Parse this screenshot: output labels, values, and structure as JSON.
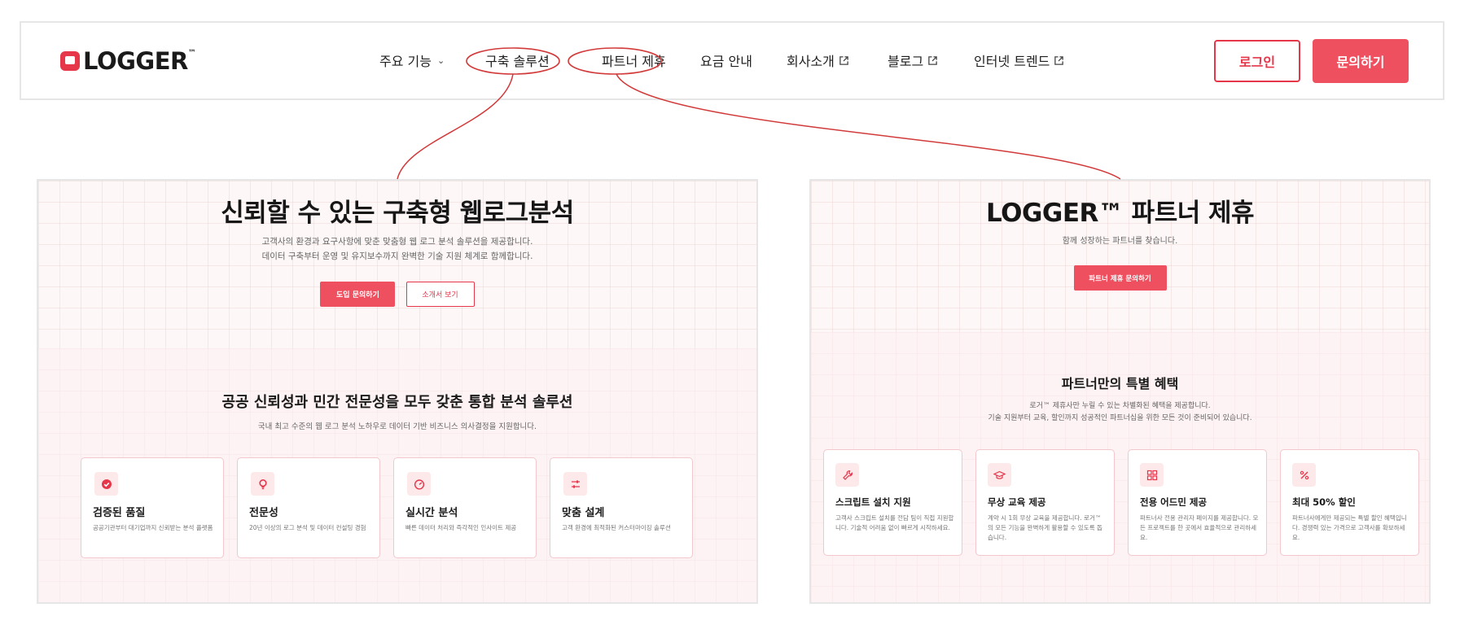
{
  "header": {
    "logo_text": "LOGGER",
    "logo_tm": "™",
    "nav": [
      {
        "label": "주요 기능",
        "has_dropdown": true
      },
      {
        "label": "구축 솔루션"
      },
      {
        "label": "파트너 제휴"
      },
      {
        "label": "요금 안내"
      },
      {
        "label": "회사소개",
        "external": true
      },
      {
        "label": "블로그",
        "external": true
      },
      {
        "label": "인터넷 트렌드",
        "external": true
      }
    ],
    "chevron": "⌄",
    "login_label": "로그인",
    "contact_label": "문의하기"
  },
  "solution_page": {
    "title": "신뢰할 수 있는 구축형 웹로그분석",
    "subtitle_line1": "고객사의 환경과 요구사항에 맞춘 맞춤형 웹 로그 분석 솔루션을 제공합니다.",
    "subtitle_line2": "데이터 구축부터 운영 및 유지보수까지 완벽한 기술 지원 체계로 함께합니다.",
    "primary_button": "도입 문의하기",
    "secondary_button": "소개서 보기",
    "section_title": "공공 신뢰성과 민간 전문성을 모두 갖춘 통합 분석 솔루션",
    "section_subtitle": "국내 최고 수준의 웹 로그 분석 노하우로 데이터 기반 비즈니스 의사결정을 지원합니다.",
    "cards": [
      {
        "icon": "verified-badge-icon",
        "title": "검증된 품질",
        "desc": "공공기관부터 대기업까지 신뢰받는 분석 플랫폼"
      },
      {
        "icon": "lightbulb-icon",
        "title": "전문성",
        "desc": "20년 이상의 로그 분석 및 데이터 컨설팅 경험"
      },
      {
        "icon": "speedometer-icon",
        "title": "실시간 분석",
        "desc": "빠른 데이터 처리와 즉각적인 인사이트 제공"
      },
      {
        "icon": "sliders-icon",
        "title": "맞춤 설계",
        "desc": "고객 환경에 최적화된 커스터마이징 솔루션"
      }
    ]
  },
  "partner_page": {
    "title": "LOGGER™ 파트너 제휴",
    "subtitle": "함께 성장하는 파트너를 찾습니다.",
    "primary_button": "파트너 제휴 문의하기",
    "section_title": "파트너만의 특별 혜택",
    "section_subtitle_line1": "로거™ 제휴사만 누릴 수 있는 차별화된 혜택을 제공합니다.",
    "section_subtitle_line2": "기술 지원부터 교육, 할인까지 성공적인 파트너십을 위한 모든 것이 준비되어 있습니다.",
    "cards": [
      {
        "icon": "wrench-icon",
        "title": "스크립트 설치 지원",
        "desc": "고객사 스크립트 설치를 전담 팀이 직접 지원합니다. 기술적 어려움 없이 빠르게 시작하세요."
      },
      {
        "icon": "graduation-cap-icon",
        "title": "무상 교육 제공",
        "desc": "계약 시 1회 무상 교육을 제공합니다. 로거™의 모든 기능을 완벽하게 활용할 수 있도록 돕습니다."
      },
      {
        "icon": "dashboard-grid-icon",
        "title": "전용 어드민 제공",
        "desc": "파트너사 전용 관리자 페이지를 제공합니다. 모든 프로젝트를 한 곳에서 효율적으로 관리하세요."
      },
      {
        "icon": "percent-icon",
        "title": "최대 50% 할인",
        "desc": "파트너사에게만 제공되는 특별 할인 혜택입니다. 경쟁력 있는 가격으로 고객사를 확보하세요."
      }
    ]
  },
  "colors": {
    "accent": "#e5364a",
    "accent_fill": "#ef5060",
    "annotation": "#d23a3a",
    "card_border": "#f4c7cc",
    "icon_bg": "#fde8ea"
  }
}
